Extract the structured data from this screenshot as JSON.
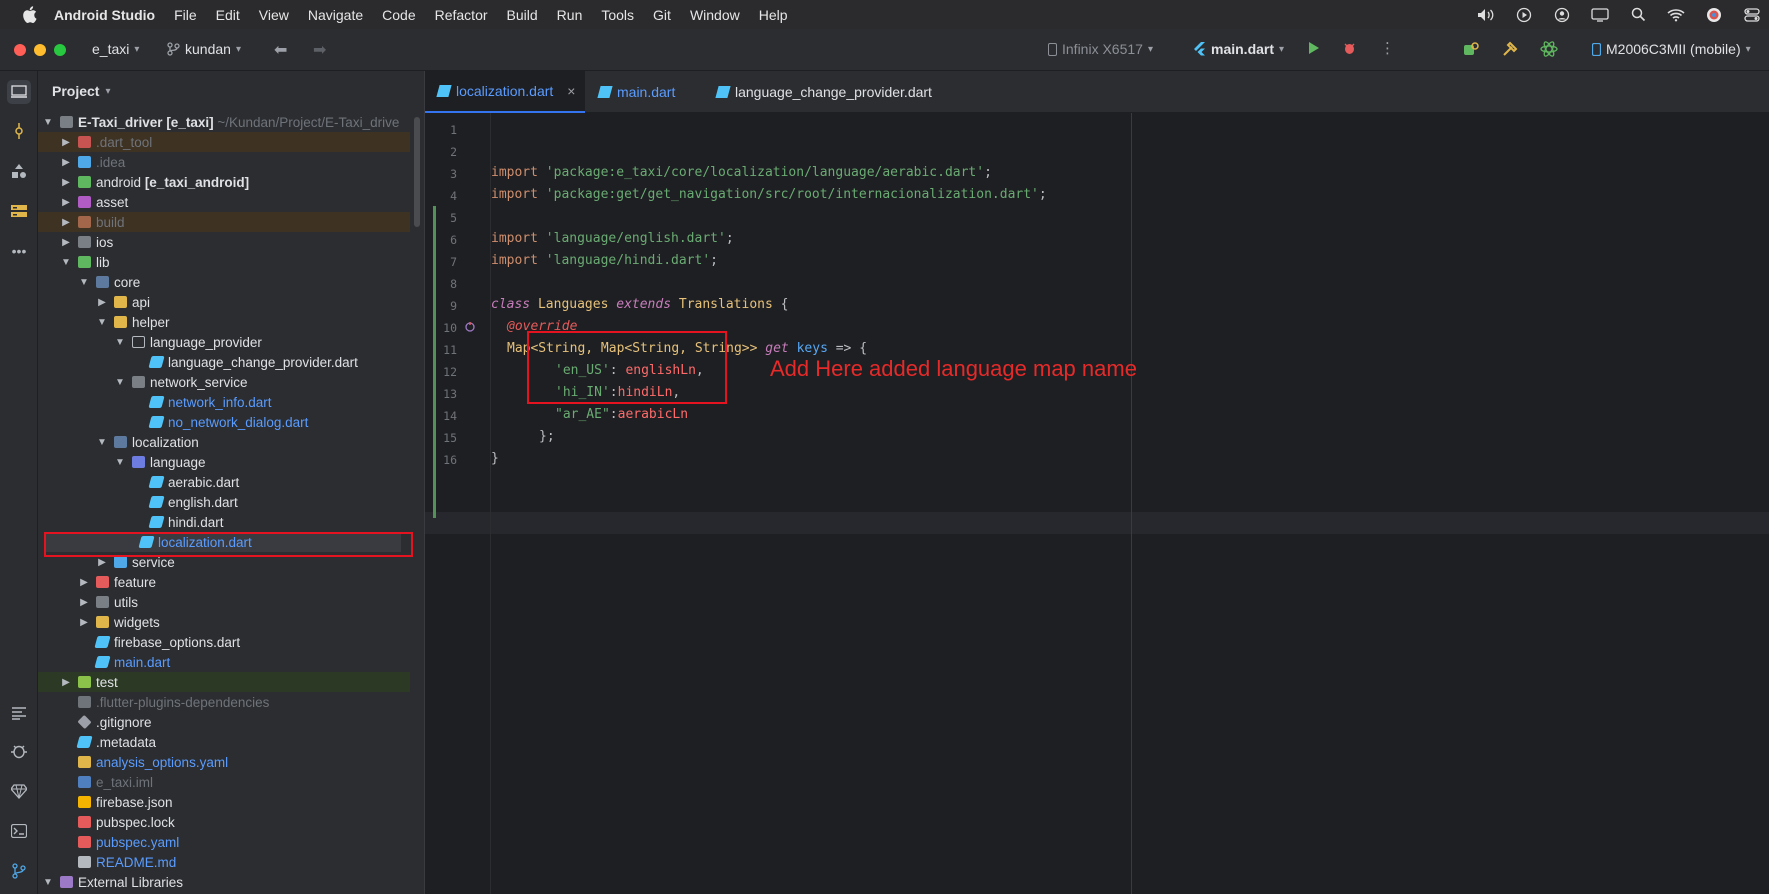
{
  "menubar": {
    "app_name": "Android Studio",
    "items": [
      "File",
      "Edit",
      "View",
      "Navigate",
      "Code",
      "Refactor",
      "Build",
      "Run",
      "Tools",
      "Git",
      "Window",
      "Help"
    ],
    "status_icons": [
      "volume-icon",
      "play-circle-icon",
      "user-circle-icon",
      "display-icon",
      "search-icon",
      "wifi-icon",
      "avatar-icon",
      "control-center-icon"
    ]
  },
  "toolbar": {
    "project_name": "e_taxi",
    "branch": "kundan",
    "device": "Infinix X6517",
    "run_config": "main.dart",
    "target_device": "M2006C3MII (mobile)"
  },
  "project_panel": {
    "title": "Project",
    "root_name": "E-Taxi_driver",
    "root_module": "[e_taxi]",
    "root_path": "~/Kundan/Project/E-Taxi_drive",
    "items": [
      {
        "label": ".dart_tool"
      },
      {
        "label": ".idea"
      },
      {
        "label": "android",
        "module": "[e_taxi_android]"
      },
      {
        "label": "asset"
      },
      {
        "label": "build"
      },
      {
        "label": "ios"
      },
      {
        "label": "lib"
      },
      {
        "label": "core"
      },
      {
        "label": "api"
      },
      {
        "label": "helper"
      },
      {
        "label": "language_provider"
      },
      {
        "label": "language_change_provider.dart"
      },
      {
        "label": "network_service"
      },
      {
        "label": "network_info.dart"
      },
      {
        "label": "no_network_dialog.dart"
      },
      {
        "label": "localization"
      },
      {
        "label": "language"
      },
      {
        "label": "aerabic.dart"
      },
      {
        "label": "english.dart"
      },
      {
        "label": "hindi.dart"
      },
      {
        "label": "localization.dart"
      },
      {
        "label": "service"
      },
      {
        "label": "feature"
      },
      {
        "label": "utils"
      },
      {
        "label": "widgets"
      },
      {
        "label": "firebase_options.dart"
      },
      {
        "label": "main.dart"
      },
      {
        "label": "test"
      },
      {
        "label": ".flutter-plugins-dependencies"
      },
      {
        "label": ".gitignore"
      },
      {
        "label": ".metadata"
      },
      {
        "label": "analysis_options.yaml"
      },
      {
        "label": "e_taxi.iml"
      },
      {
        "label": "firebase.json"
      },
      {
        "label": "pubspec.lock"
      },
      {
        "label": "pubspec.yaml"
      },
      {
        "label": "README.md"
      },
      {
        "label": "External Libraries"
      }
    ]
  },
  "editor": {
    "tabs": [
      {
        "label": "localization.dart",
        "close": "×"
      },
      {
        "label": "main.dart"
      },
      {
        "label": "language_change_provider.dart"
      }
    ],
    "line_numbers": [
      "1",
      "2",
      "3",
      "4",
      "5",
      "6",
      "7",
      "8",
      "9",
      "10",
      "11",
      "12",
      "13",
      "14",
      "15",
      "16"
    ],
    "code": {
      "import_kw": "import",
      "l2_str": "'package:e_taxi/core/localization/language/aerabic.dart'",
      "l3_str": "'package:get/get_navigation/src/root/internacionalization.dart'",
      "l5_str": "'language/english.dart'",
      "l6_str": "'language/hindi.dart'",
      "semi": ";",
      "class_kw": "class",
      "class_name": "Languages",
      "extends_kw": "extends",
      "super_name": "Translations",
      "brace_open": " {",
      "override": "@override",
      "l10_type": "Map<String, Map<String, String>>",
      "get_kw": "get",
      "keys": "keys",
      "arrow": " => {",
      "l11_key": "'en_US'",
      "l11_val": "englishLn",
      "l12_key": "'hi_IN'",
      "l12_val": "hindiLn",
      "l13_key": "\"ar_AE\"",
      "l13_val": "aerabicLn",
      "l14": "};",
      "l15": "}"
    },
    "annotation": "Add Here added language map name"
  }
}
